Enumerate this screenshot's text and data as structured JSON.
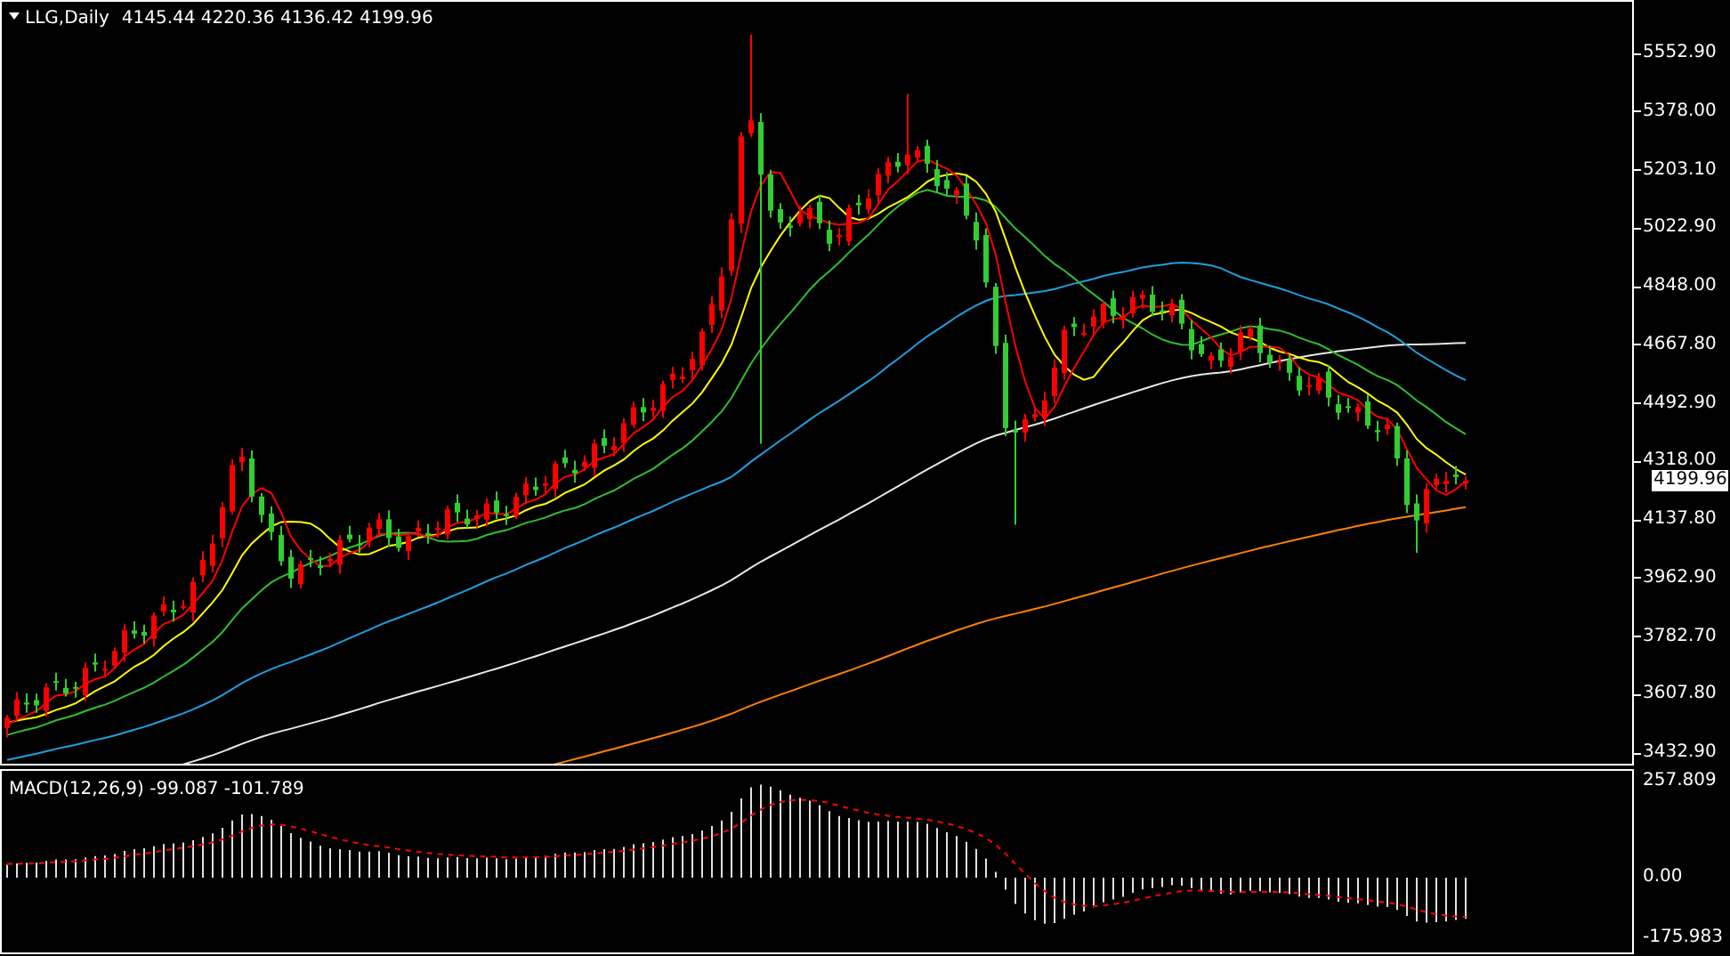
{
  "chart": {
    "title": "LLG,Daily",
    "ohlc": "4145.44 4220.36 4136.42 4199.96",
    "y_axis_labels": [
      "5552.90",
      "5378.00",
      "5203.10",
      "5022.90",
      "4848.00",
      "4667.80",
      "4492.90",
      "4318.00",
      "4137.80",
      "3962.90",
      "3782.70",
      "3607.80",
      "3432.90"
    ],
    "current_price": "4199.96"
  },
  "macd": {
    "title": "MACD(12,26,9) -99.087 -101.789",
    "y_axis_labels": [
      "257.809",
      "0.00",
      "-175.983"
    ]
  }
}
